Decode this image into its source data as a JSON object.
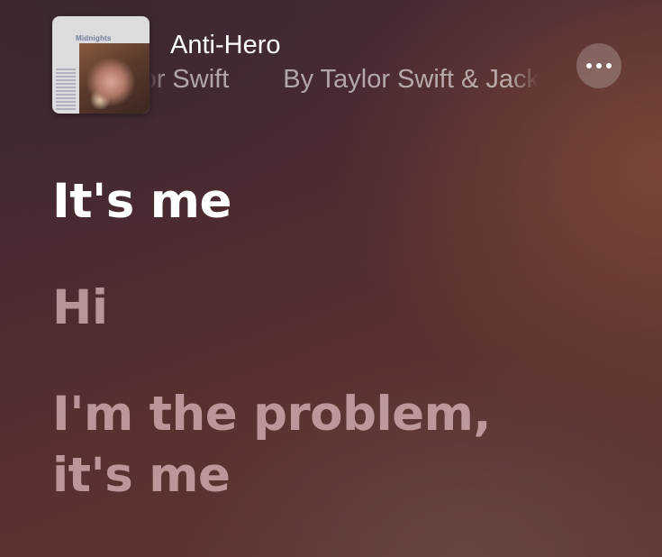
{
  "now_playing": {
    "album_art_text": "Midnights",
    "track_title": "Anti-Hero",
    "artist_marquee": [
      "Taylor Swift",
      "By Taylor Swift & Jack Antonoff"
    ]
  },
  "icons": {
    "more_button": "ellipsis-icon"
  },
  "lyrics": {
    "lines": [
      {
        "text": "It's me",
        "state": "active"
      },
      {
        "text": "Hi",
        "state": "upcoming"
      },
      {
        "text": "I'm the problem,\nit's me",
        "state": "upcoming"
      }
    ]
  }
}
